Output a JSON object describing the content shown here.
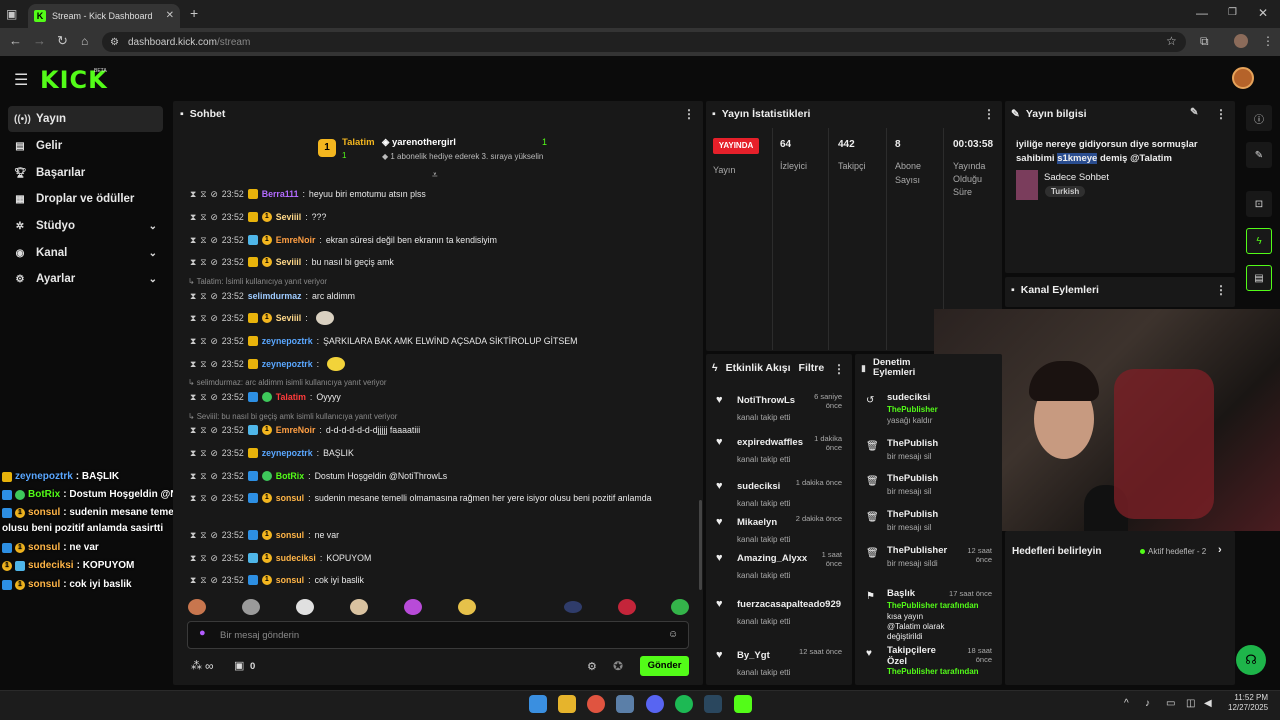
{
  "browser": {
    "tab_title": "Stream - Kick Dashboard",
    "url_host": "dashboard.kick.com",
    "url_path": "/stream"
  },
  "app": {
    "logo": "KICK",
    "logo_beta": "BETA"
  },
  "sidebar": {
    "items": [
      {
        "label": "Yayın",
        "icon": "broadcast-icon"
      },
      {
        "label": "Gelir",
        "icon": "money-icon"
      },
      {
        "label": "Başarılar",
        "icon": "trophy-icon"
      },
      {
        "label": "Droplar ve ödüller",
        "icon": "gift-icon"
      },
      {
        "label": "Stüdyo",
        "icon": "studio-icon"
      },
      {
        "label": "Kanal",
        "icon": "channel-icon"
      },
      {
        "label": "Ayarlar",
        "icon": "gear-icon"
      }
    ]
  },
  "chat": {
    "title": "Sohbet",
    "pinned": {
      "rank_user": "Talatim",
      "rank_count": "1",
      "gifter": "yarenothergirl",
      "gifter_count": "1",
      "note": "1 abonelik hediye ederek 3. sıraya yükselin"
    },
    "messages": [
      {
        "time": "23:52",
        "user": "Berra111",
        "text": "heyuu biri emotumu atsın plss",
        "color": "#b36bff"
      },
      {
        "time": "23:52",
        "user": "Seviiil",
        "text": "???",
        "color": "#ffd98a"
      },
      {
        "time": "23:52",
        "user": "EmreNoir",
        "text": "ekran süresi değil ben ekranın ta kendisiyim",
        "color": "#ff9f43"
      },
      {
        "time": "23:52",
        "user": "Seviiil",
        "text": "bu nasıl bi geçiş amk",
        "color": "#ffd98a"
      },
      {
        "time": "23:52",
        "user": "selimdurmaz",
        "text": "arc aldimm",
        "color": "#9ecbff"
      },
      {
        "time": "23:52",
        "user": "Seviiil",
        "text": "",
        "color": "#ffd98a"
      },
      {
        "time": "23:52",
        "user": "zeynepoztrk",
        "text": "ŞARKILARA BAK AMK ELWİND AÇSADA SİKTİROLUP GİTSEM",
        "color": "#5aa7ff"
      },
      {
        "time": "23:52",
        "user": "zeynepoztrk",
        "text": "",
        "color": "#5aa7ff"
      },
      {
        "time": "23:52",
        "user": "Talatim",
        "text": "Oyyyy",
        "color": "#ff3b3b"
      },
      {
        "time": "23:52",
        "user": "EmreNoir",
        "text": "d-d-d-d-d-d-djjjjj faaaatiii",
        "color": "#ff9f43"
      },
      {
        "time": "23:52",
        "user": "zeynepoztrk",
        "text": "BAŞLIK",
        "color": "#5aa7ff"
      },
      {
        "time": "23:52",
        "user": "BotRix",
        "text": "Dostum Hoşgeldin @NotiThrowLs",
        "color": "#53fc18"
      },
      {
        "time": "23:52",
        "user": "sonsul",
        "text": "sudenin mesane temelli olmamasına rağmen her yere isiyor olusu beni pozitif anlamda",
        "color": "#ffb547"
      },
      {
        "time": "23:52",
        "user": "sonsul",
        "text": "ne var",
        "color": "#ffb547"
      },
      {
        "time": "23:52",
        "user": "sudeciksi",
        "text": "KOPUYOM",
        "color": "#ffb547"
      },
      {
        "time": "23:52",
        "user": "sonsul",
        "text": "cok iyi baslik",
        "color": "#ffb547"
      }
    ],
    "replies": [
      {
        "label": "Talatim:",
        "text": "İsimli kullanıcıya yanıt veriyor"
      },
      {
        "label": "selimdurmaz: arc aldimm",
        "text": "isimli kullanıcıya yanıt veriyor"
      },
      {
        "label": "Seviiil: bu nasıl bi geçiş amk",
        "text": "isimli kullanıcıya yanıt veriyor"
      }
    ],
    "input_placeholder": "Bir mesaj gönderin",
    "send_label": "Gönder",
    "points_value": "∞",
    "gift_count": "0"
  },
  "overlay_chat": [
    {
      "user": "zeynepoztrk",
      "text": ": BAŞLIK",
      "color": "#5aa7ff"
    },
    {
      "user": "BotRix",
      "text": ": Dostum Hoşgeldin @NotiThrowLs",
      "color": "#53fc18"
    },
    {
      "user": "sonsul",
      "text": ": sudenin mesane temelli olmamasına rağmen her yere isiyor",
      "color": "#ffb547"
    },
    {
      "user": "",
      "text": "olusu beni pozitif anlamda sasirtti",
      "color": "#ffffff"
    },
    {
      "user": "sonsul",
      "text": ": ne var",
      "color": "#ffb547"
    },
    {
      "user": "sudeciksi",
      "text": ": KOPUYOM",
      "color": "#ffb547"
    },
    {
      "user": "sonsul",
      "text": ": cok iyi baslik",
      "color": "#ffb547"
    }
  ],
  "stats": {
    "title": "Yayın İstatistikleri",
    "live_label": "YAYINDA",
    "live_sub": "Yayın",
    "viewers_value": "64",
    "viewers_label": "İzleyici",
    "followers_value": "442",
    "followers_label": "Takipçi",
    "subs_value": "8",
    "subs_label1": "Abone",
    "subs_label2": "Sayısı",
    "uptime_value": "00:03:58",
    "uptime_label1": "Yayında",
    "uptime_label2": "Olduğu",
    "uptime_label3": "Süre"
  },
  "stream_info": {
    "title": "Yayın bilgisi",
    "text_pre": "iyiliğe nereye gidiyorsun diye sormuşlar sahibimi ",
    "text_highlight": "s1kmeye",
    "text_post": " demiş @Talatim",
    "category": "Sadece Sohbet",
    "tag": "Turkish"
  },
  "channel_actions": {
    "title": "Kanal Eylemleri"
  },
  "activity": {
    "title": "Etkinlik Akışı",
    "filter": "Filtre",
    "items": [
      {
        "user": "NotiThrowLs",
        "action": "kanalı takip etti",
        "time1": "6 saniye",
        "time2": "önce"
      },
      {
        "user": "expiredwaffles",
        "action": "kanalı takip etti",
        "time1": "1 dakika",
        "time2": "önce"
      },
      {
        "user": "sudeciksi",
        "action": "kanalı takip etti",
        "time1": "1 dakika önce",
        "time2": ""
      },
      {
        "user": "Mikaelyn",
        "action": "kanalı takip etti",
        "time1": "2 dakika önce",
        "time2": ""
      },
      {
        "user": "Amazing_Alyxx",
        "action": "kanalı takip etti",
        "time1": "1 saat",
        "time2": "önce"
      },
      {
        "user": "fuerzacasapalteado929",
        "action": "kanalı takip etti",
        "time1": "",
        "time2": ""
      },
      {
        "user": "By_Ygt",
        "action": "kanalı takip etti",
        "time1": "12 saat önce",
        "time2": ""
      }
    ]
  },
  "moderation": {
    "title1": "Denetim",
    "title2": "Eylemleri",
    "items": [
      {
        "user": "sudeciksi",
        "line1": "ThePublisher",
        "line2": "yasağı kaldır",
        "time1": "",
        "time2": "",
        "icon": "unban-icon"
      },
      {
        "user": "ThePublish",
        "line1": "",
        "line2": "bir mesajı sil",
        "time1": "",
        "time2": "",
        "icon": "trash-icon"
      },
      {
        "user": "ThePublish",
        "line1": "",
        "line2": "bir mesajı sil",
        "time1": "",
        "time2": "",
        "icon": "trash-icon"
      },
      {
        "user": "ThePublish",
        "line1": "",
        "line2": "bir mesajı sil",
        "time1": "",
        "time2": "",
        "icon": "trash-icon"
      },
      {
        "user": "ThePublisher",
        "line1": "",
        "line2": "bir mesajı sildi",
        "time1": "12 saat",
        "time2": "önce",
        "icon": "trash-icon"
      },
      {
        "user": "Başlık",
        "line1": "ThePublisher tarafından",
        "line2": "kısa yayın @Talatim olarak değiştirildi",
        "time1": "17 saat önce",
        "time2": "",
        "icon": "title-icon"
      },
      {
        "user": "Takipçilere Özel",
        "line1": "ThePublisher tarafından",
        "line2": "",
        "time1": "18 saat",
        "time2": "önce",
        "icon": "heart-icon"
      }
    ]
  },
  "goals": {
    "title": "Hedefleri belirleyin",
    "active": "Aktif hedefler - 2"
  },
  "taskbar": {
    "time": "11:52 PM",
    "date": "12/27/2025"
  },
  "colors": {
    "accent": "#53fc18",
    "live": "#e5202a",
    "panel": "#181818"
  }
}
